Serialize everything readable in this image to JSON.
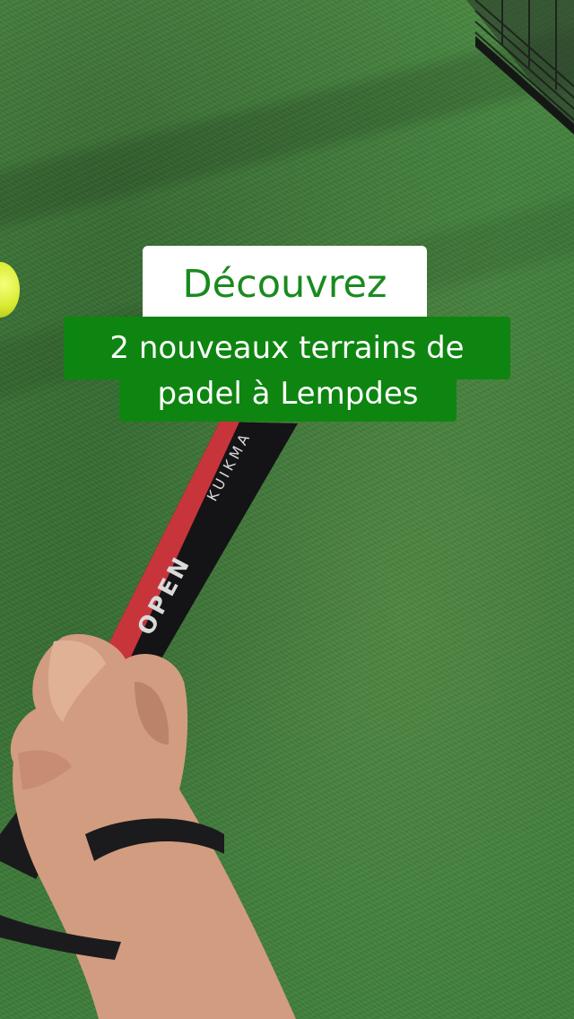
{
  "caption": {
    "line1": "Découvrez",
    "line2": "2 nouveaux terrains de",
    "line3": "padel à Lempdes"
  },
  "racket": {
    "brand": "KUIKMA",
    "model": "OPEN"
  },
  "colors": {
    "caption_green": "#0e8510",
    "caption_title_text": "#1a8a1f",
    "turf": "#3f7d3a",
    "ball": "#d8ea2e"
  }
}
